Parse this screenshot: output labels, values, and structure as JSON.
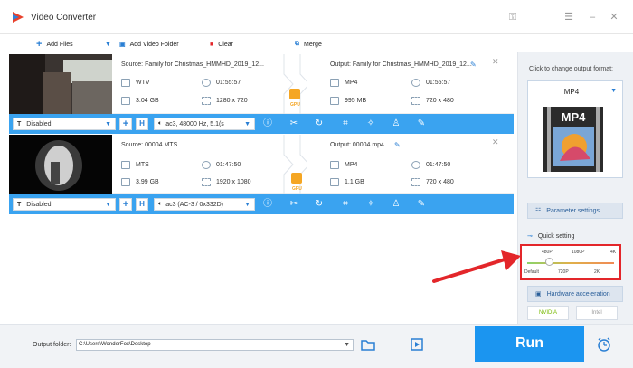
{
  "app": {
    "title": "Video Converter",
    "colors": {
      "accent": "#3aa3f0",
      "run": "#1b95f0",
      "annotation": "#e3262a"
    }
  },
  "titlebar_icons": [
    "key-icon",
    "menu-icon",
    "minimize-icon",
    "close-icon"
  ],
  "toolbar": {
    "add_files": "Add Files",
    "add_video_folder": "Add Video Folder",
    "clear": "Clear",
    "merge": "Merge"
  },
  "files": [
    {
      "source_title": "Source: Family for Christmas_HMMHD_2019_12...",
      "source_format": "WTV",
      "source_duration": "01:55:57",
      "source_size": "3.04 GB",
      "source_resolution": "1280 x 720",
      "output_title": "Output: Family for Christmas_HMMHD_2019_12...",
      "output_format": "MP4",
      "output_duration": "01:55:57",
      "output_size": "995 MB",
      "output_resolution": "720 x 480",
      "gpu_label": "GPU",
      "subtitle": "Disabled",
      "audio": "ac3, 48000 Hz, 5.1(s"
    },
    {
      "source_title": "Source: 00004.MTS",
      "source_format": "MTS",
      "source_duration": "01:47:50",
      "source_size": "3.99 GB",
      "source_resolution": "1920 x 1080",
      "output_title": "Output: 00004.mp4",
      "output_format": "MP4",
      "output_duration": "01:47:50",
      "output_size": "1.1 GB",
      "output_resolution": "720 x 480",
      "gpu_label": "GPU",
      "subtitle": "Disabled",
      "audio": "ac3 (AC-3 / 0x332D)"
    }
  ],
  "right_panel": {
    "change_format_label": "Click to change output format:",
    "format": "MP4",
    "format_badge": "MP4",
    "parameter_settings": "Parameter settings",
    "quick_setting": "Quick setting",
    "quick_top": [
      "480P",
      "1080P",
      "4K"
    ],
    "quick_bottom": [
      "Default",
      "720P",
      "2K"
    ],
    "quick_level": 0.25,
    "hardware_acceleration": "Hardware acceleration",
    "vendors": [
      "NVIDIA",
      "Intel"
    ]
  },
  "bottom": {
    "output_folder_label": "Output folder:",
    "output_folder_value": "C:\\Users\\WonderFox\\Desktop",
    "run": "Run"
  }
}
